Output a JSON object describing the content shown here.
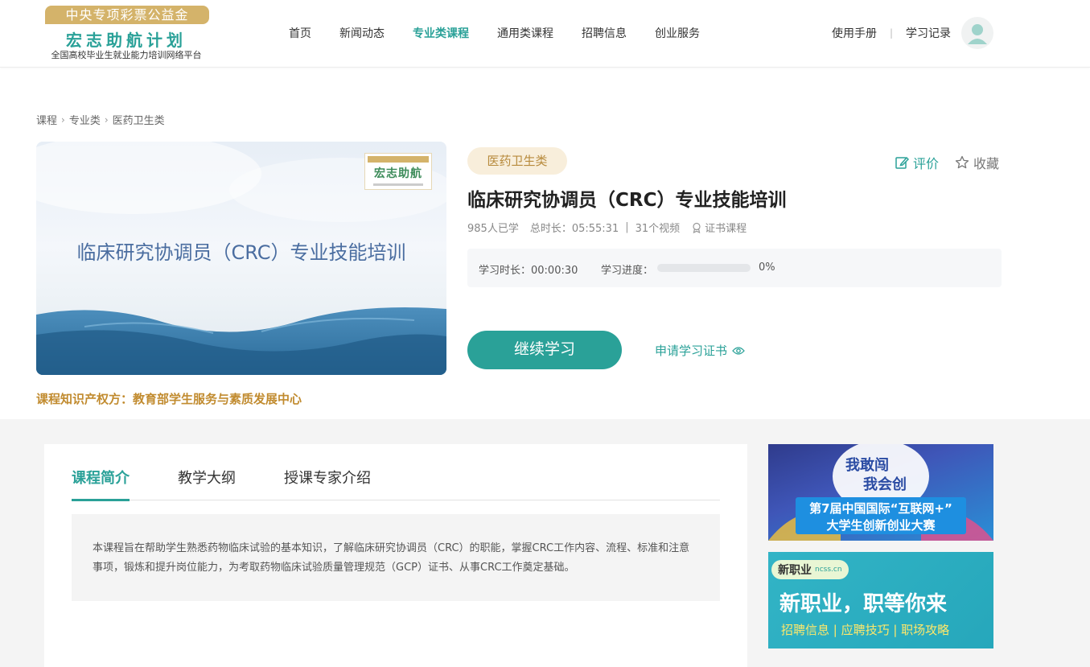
{
  "logo": {
    "top": "中央专项彩票公益金",
    "main": "宏志助航计划",
    "sub": "全国高校毕业生就业能力培训网络平台"
  },
  "nav": {
    "items": [
      "首页",
      "新闻动态",
      "专业类课程",
      "通用类课程",
      "招聘信息",
      "创业服务"
    ],
    "active_index": 2
  },
  "header_right": {
    "manual": "使用手册",
    "separator": "|",
    "records": "学习记录"
  },
  "breadcrumb": [
    "课程",
    "专业类",
    "医药卫生类"
  ],
  "cover": {
    "title": "临床研究协调员（CRC）专业技能培训",
    "badge_text": "宏志助航"
  },
  "ip_owner": "课程知识产权方：教育部学生服务与素质发展中心",
  "course": {
    "category": "医药卫生类",
    "title": "临床研究协调员（CRC）专业技能培训",
    "learners": "985人已学",
    "duration": "总时长：05:55:31",
    "videos": "31个视频",
    "cert": "证书课程"
  },
  "actions": {
    "rate": "评价",
    "favorite": "收藏"
  },
  "progress": {
    "time_label": "学习时长：00:00:30",
    "progress_label": "学习进度：",
    "percent_text": "0%",
    "fraction": 0.0
  },
  "buttons": {
    "continue": "继续学习",
    "apply_cert": "申请学习证书"
  },
  "tabs": [
    "课程简介",
    "教学大纲",
    "授课专家介绍"
  ],
  "intro_text": "本课程旨在帮助学生熟悉药物临床试验的基本知识，了解临床研究协调员（CRC）的职能，掌握CRC工作内容、流程、标准和注意事项，锻炼和提升岗位能力，为考取药物临床试验质量管理规范（GCP）证书、从事CRC工作奠定基础。",
  "ads": {
    "ad1": {
      "slogan1": "我敢闯",
      "slogan2": "我会创",
      "line1": "第7届中国国际“互联网+”",
      "line2": "大学生创新创业大赛"
    },
    "ad2": {
      "brand": "新职业",
      "brand_site": "ncss.cn",
      "headline": "新职业，职等你来",
      "links": "招聘信息 | 应聘技巧 | 职场攻略"
    }
  },
  "colors": {
    "accent": "#2aa198",
    "gold": "#c18b2f",
    "tag_bg": "#f8eedb"
  }
}
